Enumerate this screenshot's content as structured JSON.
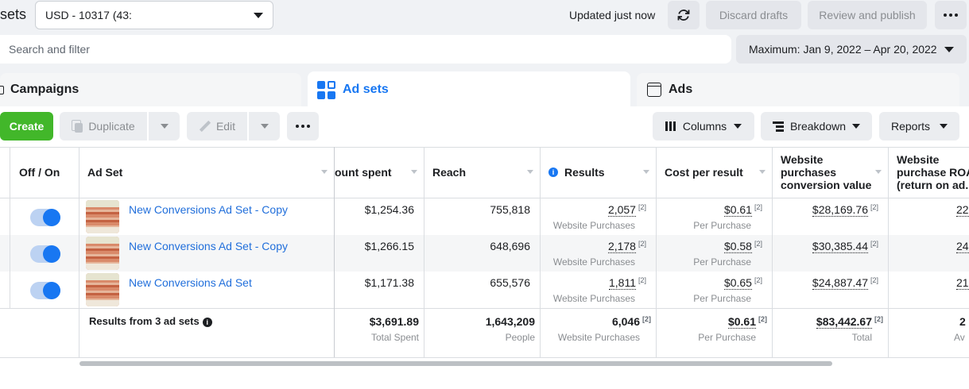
{
  "header": {
    "title_fragment": "sets",
    "account_select": "USD - 10317 (43:",
    "updated": "Updated just now",
    "discard": "Discard drafts",
    "review": "Review and publish"
  },
  "search": {
    "placeholder": "Search and filter"
  },
  "date_range": "Maximum: Jan 9, 2022 – Apr 20, 2022",
  "tabs": {
    "campaigns": "Campaigns",
    "adsets": "Ad sets",
    "ads": "Ads"
  },
  "toolbar": {
    "create": "Create",
    "duplicate": "Duplicate",
    "edit": "Edit",
    "columns": "Columns",
    "breakdown": "Breakdown",
    "reports": "Reports"
  },
  "columns": {
    "off_on": "Off / On",
    "ad_set": "Ad Set",
    "amount_spent": "ount spent",
    "reach": "Reach",
    "results": "Results",
    "cost_per_result": "Cost per result",
    "wp_value_1": "Website",
    "wp_value_2": "purchases",
    "wp_value_3": "conversion value",
    "roas_1": "Website",
    "roas_2": "purchase ROA",
    "roas_3": "(return on ad..."
  },
  "rows": [
    {
      "name": "New Conversions Ad Set - Copy",
      "spent": "$1,254.36",
      "reach": "755,818",
      "results": "2,057",
      "results_sub": "Website Purchases",
      "cost": "$0.61",
      "cost_sub": "Per Purchase",
      "value": "$28,169.76",
      "roas": "22",
      "sup": "[2]"
    },
    {
      "name": "New Conversions Ad Set - Copy",
      "spent": "$1,266.15",
      "reach": "648,696",
      "results": "2,178",
      "results_sub": "Website Purchases",
      "cost": "$0.58",
      "cost_sub": "Per Purchase",
      "value": "$30,385.44",
      "roas": "24",
      "sup": "[2]"
    },
    {
      "name": "New Conversions Ad Set",
      "spent": "$1,171.38",
      "reach": "655,576",
      "results": "1,811",
      "results_sub": "Website Purchases",
      "cost": "$0.65",
      "cost_sub": "Per Purchase",
      "value": "$24,887.47",
      "roas": "21",
      "sup": "[2]"
    }
  ],
  "totals": {
    "label": "Results from 3 ad sets",
    "spent": "$3,691.89",
    "spent_sub": "Total Spent",
    "reach": "1,643,209",
    "reach_sub": "People",
    "results": "6,046",
    "results_sub": "Website Purchases",
    "cost": "$0.61",
    "cost_sub": "Per Purchase",
    "value": "$83,442.67",
    "value_sub": "Total",
    "roas": "2",
    "roas_sub": "Av",
    "sup": "[2]"
  },
  "icons": {
    "refresh": "refresh-icon",
    "more": "more-icon",
    "info": "i"
  }
}
